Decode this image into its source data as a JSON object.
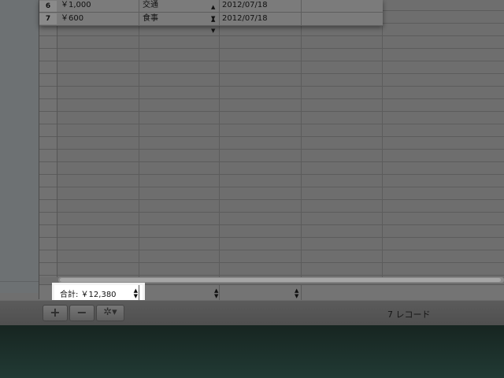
{
  "table": {
    "rows": [
      {
        "number": "6",
        "amount": "￥1,000",
        "category": "交通",
        "date": "2012/07/18"
      },
      {
        "number": "7",
        "amount": "￥600",
        "category": "食事",
        "date": "2012/07/18"
      }
    ],
    "selector_arrows": "▲▼"
  },
  "footer": {
    "sum_label": "合計: ￥12,380"
  },
  "toolbar": {
    "add_label": "+",
    "remove_label": "−",
    "gear_label": "✲▾",
    "status": "7 レコード"
  }
}
